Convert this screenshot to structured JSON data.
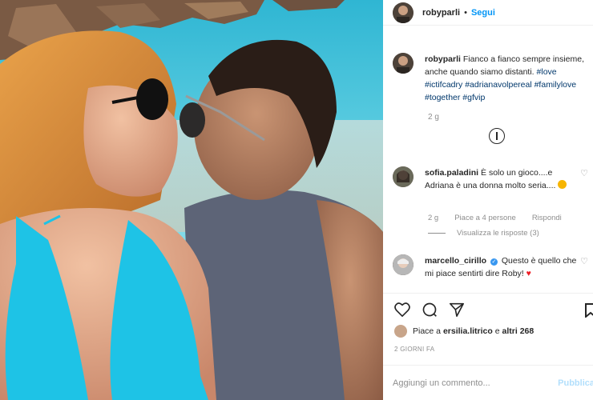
{
  "post": {
    "author": "robyparli",
    "follow_label": "Segui",
    "separator": "•",
    "caption_author": "robyparli",
    "caption_text": "Fianco a fianco sempre insieme, anche quando siamo distanti.",
    "hashtags": [
      "#love",
      "#ictifcadry",
      "#adrianavolpereal",
      "#familylove",
      "#together",
      "#gfvip"
    ],
    "age": "2 g"
  },
  "comments": [
    {
      "author": "sofia.paladini",
      "text": "È solo un gioco....e Adriana è una donna molto seria....",
      "emoji": "star-struck-face",
      "age": "2 g",
      "likes": "Piace a 4 persone",
      "reply_label": "Rispondi",
      "view_replies": "Visualizza le risposte (3)"
    },
    {
      "author": "marcello_cirillo",
      "verified": true,
      "text": "Questo è quello che mi piace sentirti dire Roby!",
      "emoji": "red-heart"
    }
  ],
  "likes": {
    "prefix": "Piace a",
    "user": "ersilia.litrico",
    "joiner": "e",
    "others": "altri 268"
  },
  "date": "2 GIORNI FA",
  "comment_input": {
    "placeholder": "Aggiungi un commento...",
    "publish_label": "Pubblica"
  },
  "colors": {
    "link_blue": "#0095f6",
    "hashtag": "#00376b",
    "muted": "#8e8e8e",
    "publish_disabled": "#b2dffc",
    "sea": "#3ec0d8",
    "bikini": "#1ec3e6"
  },
  "icons": [
    "heart-icon",
    "comment-icon",
    "share-icon",
    "bookmark-icon",
    "more-options-icon",
    "verified-badge-icon"
  ]
}
